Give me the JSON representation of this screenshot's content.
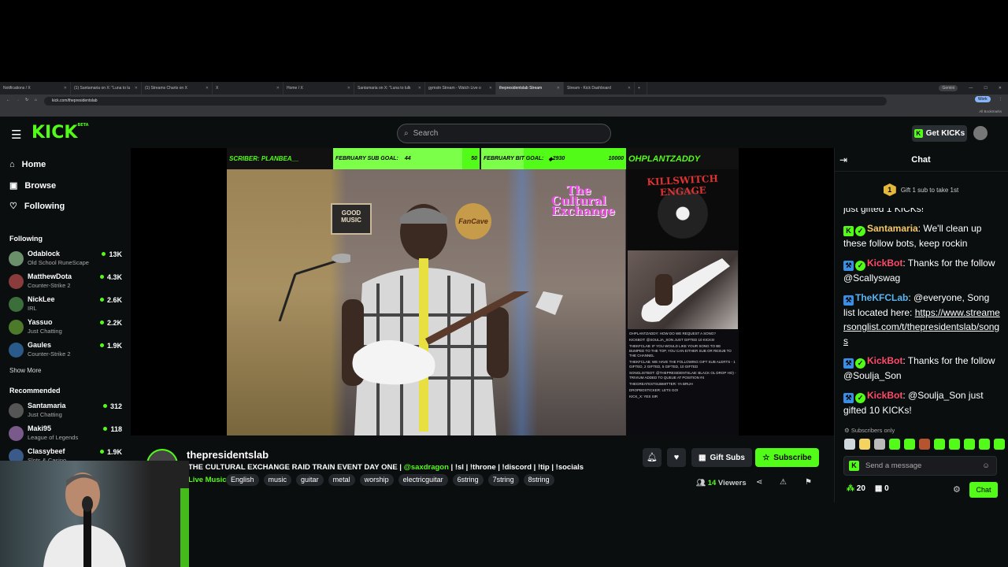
{
  "browser": {
    "tabs": [
      {
        "label": "Notifications / X",
        "active": false
      },
      {
        "label": "(1) Santamaria on X: \"Luna to lu",
        "active": false
      },
      {
        "label": "(1) Streams Charts on X",
        "active": false
      },
      {
        "label": "X",
        "active": false
      },
      {
        "label": "Home / X",
        "active": false
      },
      {
        "label": "Santamaria on X: \"Luna to lulk",
        "active": false
      },
      {
        "label": "gymstn Stream - Watch Live o",
        "active": false
      },
      {
        "label": "thepresidentslab Stream",
        "active": true
      },
      {
        "label": "Stream - Kick Dashboard",
        "active": false
      }
    ],
    "profile_label": "Gemini",
    "url": "kick.com/thepresidentslab",
    "bookmarks_label": "All Bookmarks",
    "work_label": "Work"
  },
  "header": {
    "logo": "KICK",
    "logo_sup": "BETA",
    "search_placeholder": "Search",
    "get_kicks": "Get KICKs"
  },
  "sidebar": {
    "nav": [
      {
        "label": "Home",
        "icon": "home-icon"
      },
      {
        "label": "Browse",
        "icon": "browse-icon"
      },
      {
        "label": "Following",
        "icon": "heart-icon"
      }
    ],
    "following_header": "Following",
    "following": [
      {
        "name": "Odablock",
        "category": "Old School RuneScape",
        "viewers": "13K",
        "color": "#6b8e6b"
      },
      {
        "name": "MatthewDota",
        "category": "Counter-Strike 2",
        "viewers": "4.3K",
        "color": "#8a3b3b"
      },
      {
        "name": "NickLee",
        "category": "IRL",
        "viewers": "2.6K",
        "color": "#3b6e3b"
      },
      {
        "name": "Yassuo",
        "category": "Just Chatting",
        "viewers": "2.2K",
        "color": "#4d7a2a"
      },
      {
        "name": "Gaules",
        "category": "Counter-Strike 2",
        "viewers": "1.9K",
        "color": "#2a5a8a"
      }
    ],
    "show_more": "Show More",
    "recommended_header": "Recommended",
    "recommended": [
      {
        "name": "Santamaria",
        "category": "Just Chatting",
        "viewers": "312",
        "color": "#555"
      },
      {
        "name": "Maki95",
        "category": "League of Legends",
        "viewers": "118",
        "color": "#7a5a8a"
      },
      {
        "name": "Classybeef",
        "category": "Slots & Casino",
        "viewers": "1.9K",
        "color": "#3a5a8a"
      }
    ]
  },
  "video": {
    "overlay": {
      "subscriber": "SCRIBER: PLANBEA__",
      "sub_goal_label": "FEBRUARY SUB GOAL:",
      "sub_goal_current": "44",
      "sub_goal_target": "50",
      "bit_goal_label": "FEBRUARY BIT GOAL:",
      "bit_goal_current": "2930",
      "bit_goal_target": "10000",
      "follower": "OHPLANTZADDY"
    },
    "sub_goal_progress": 0.88,
    "bit_goal_progress": 0.293,
    "album_title": "KILLSWITCH ENGAGE",
    "culture_logo": "The Cultural Exchange",
    "good_music_sign": "GOOD MUSIC",
    "fan_cave_sign": "FanCave",
    "overlay_chat": [
      "OHPLANTZADDY: HOW DO WE REQUEST A SONG?",
      "KICKBOT: @SOULJA_SON JUST GIFTED 10 KICKS!",
      "THEKFCLAB: IF YOU WOULD LIKE YOUR SONG TO BE BUMPED TO THE TOP, YOU CAN EITHER SUB OR RESUB TO THE CHANNEL",
      "THEKFCLAB: WE HAVE THE FOLLOWING GIFT SUB ALERTS - 1 GIFTED, 2 GIFTED, 5 GIFTED, 10 GIFTED",
      "SONGLISTBOT: @THEPRESIDENTSLAB: BLACK OL DROP HO) - TRIVIUM ADDED TO QUEUE AT POSITION #4",
      "THEGREATESTSUBMITTER: YA BRUH",
      "DROPBOXTICKER: LETS GO!",
      "KICK_X: YES SIR"
    ]
  },
  "stream": {
    "channel": "thepresidentslab",
    "title_main": "THE CULTURAL EXCHANGE RAID TRAIN EVENT DAY ONE | ",
    "title_mention": "@saxdragon",
    "title_rest": " | !sl | !throne | !discord | !tip | !socials",
    "category": "Live Music",
    "tags": [
      "English",
      "music",
      "guitar",
      "metal",
      "worship",
      "electricguitar",
      "6string",
      "7string",
      "8string"
    ],
    "gift_subs": "Gift Subs",
    "subscribe": "Subscribe",
    "viewers_count": "14",
    "viewers_label": "Viewers"
  },
  "chat": {
    "header": "Chat",
    "gift_banner": "Gift 1 sub to take 1st",
    "gift_badge": "1",
    "partial_top": "just gifted 1 KICKs!",
    "messages": [
      {
        "user": "Santamaria",
        "color": "#f5c96a",
        "text": ": We'll clean up these follow bots, keep rockin",
        "link": ""
      },
      {
        "user": "KickBot",
        "color": "#ff4a6a",
        "text": ": Thanks for the follow @Scallyswag",
        "link": ""
      },
      {
        "user": "TheKFCLab",
        "color": "#5ab4f0",
        "text": ": @everyone, Song list located here: ",
        "link": "https://www.streamersonglist.com/t/thepresidentslab/songs"
      },
      {
        "user": "KickBot",
        "color": "#ff4a6a",
        "text": ": Thanks for the follow @Soulja_Son",
        "link": ""
      },
      {
        "user": "KickBot",
        "color": "#ff4a6a",
        "text": ": @Soulja_Son just gifted 10 KICKs!",
        "link": ""
      }
    ],
    "subscribers_only": "Subscribers only",
    "input_placeholder": "Send a message",
    "points": "20",
    "gifts": "0",
    "chat_button": "Chat"
  }
}
